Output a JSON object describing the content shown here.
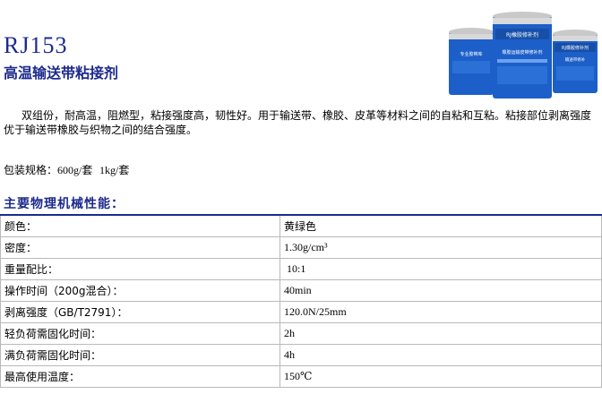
{
  "header": {
    "title": "RJ153",
    "subtitle": "高温输送带粘接剂"
  },
  "product_image": {
    "small_can_label": "专业胶带库",
    "big_can_label": "RJ橡胶修补剂",
    "big_can_text": "橡胶运输皮带修补剂",
    "right_can_label": "RJ橡胶修补剂",
    "right_can_text": "输送带修补",
    "colors": {
      "can_blue": "#1d5fc8",
      "lid": "#c9c9c9"
    }
  },
  "description": "双组份，耐高温，阻燃型，粘接强度高，韧性好。用于输送带、橡胶、皮革等材料之间的自粘和互粘。粘接部位剥离强度优于输送带橡胶与织物之间的结合强度。",
  "packaging": {
    "label": "包装规格：",
    "value_1": "600g/套",
    "value_2": "1kg/套"
  },
  "section_title": "主要物理机械性能：",
  "properties": [
    {
      "label": "颜色：",
      "value": "黄绿色"
    },
    {
      "label": "密度：",
      "value": "1.30g/cm³"
    },
    {
      "label": "重量配比：",
      "value": " 10:1"
    },
    {
      "label": "操作时间（200g混合）：",
      "value": "40min"
    },
    {
      "label": "剥离强度（GB/T2791）：",
      "value": "120.0N/25mm"
    },
    {
      "label": "轻负荷需固化时间：",
      "value": "2h"
    },
    {
      "label": "满负荷需固化时间：",
      "value": "4h"
    },
    {
      "label": "最高使用温度：",
      "value": "150℃"
    }
  ],
  "colors": {
    "heading": "#1c2a8c",
    "border": "#b9b9b9"
  }
}
